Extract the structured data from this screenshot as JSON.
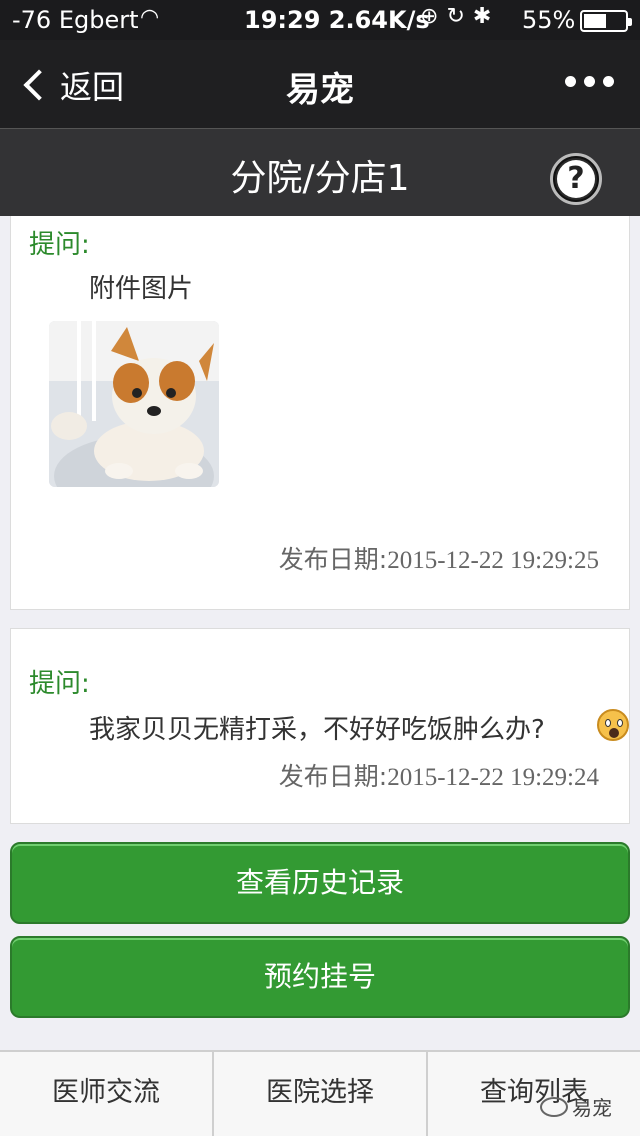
{
  "status_bar": {
    "carrier": "-76 Egbert",
    "center": "19:29 2.64K/s",
    "battery_percent": "55%",
    "battery_level": 0.55
  },
  "nav_bar": {
    "back_label": "返回",
    "title": "易宠"
  },
  "page_header": {
    "title": "分院/分店1",
    "help_symbol": "?"
  },
  "posts": [
    {
      "label": "提问:",
      "text": "附件图片",
      "date_label": "发布日期:",
      "date_value": "2015-12-22 19:29:25",
      "has_image": true
    },
    {
      "label": "提问:",
      "text": "我家贝贝无精打采，不好好吃饭肿么办?",
      "date_label": "发布日期:",
      "date_value": "2015-12-22 19:29:24",
      "emoji": "scream-emoji"
    }
  ],
  "buttons": {
    "history": "查看历史记录",
    "appointment": "预约挂号"
  },
  "tab_bar": {
    "tabs": [
      {
        "label": "医师交流"
      },
      {
        "label": "医院选择"
      },
      {
        "label": "查询列表"
      }
    ]
  },
  "watermark": "易宠"
}
